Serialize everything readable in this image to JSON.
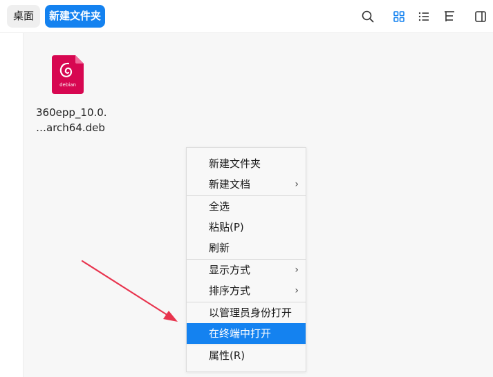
{
  "breadcrumb": {
    "items": [
      "桌面",
      "新建文件夹"
    ]
  },
  "toolbar": {
    "icons": [
      "search-icon",
      "icon-view-icon",
      "list-view-icon",
      "tree-view-icon",
      "detail-panel-icon"
    ],
    "active_view": "icon-view-icon",
    "accent_color": "#1482f0"
  },
  "files": [
    {
      "name_line1": "360epp_10.0.",
      "name_line2": "…arch64.deb",
      "icon_label": "debian",
      "icon_color": "#d70751"
    }
  ],
  "context_menu": {
    "groups": [
      [
        {
          "label": "新建文件夹",
          "submenu": false
        },
        {
          "label": "新建文档",
          "submenu": true
        }
      ],
      [
        {
          "label": "全选",
          "submenu": false
        },
        {
          "label": "粘贴(P)",
          "submenu": false
        },
        {
          "label": "刷新",
          "submenu": false
        }
      ],
      [
        {
          "label": "显示方式",
          "submenu": true
        },
        {
          "label": "排序方式",
          "submenu": true
        }
      ],
      [
        {
          "label": "以管理员身份打开",
          "submenu": false
        },
        {
          "label": "在终端中打开",
          "submenu": false,
          "highlighted": true
        },
        {
          "label": "属性(R)",
          "submenu": false
        }
      ]
    ],
    "submenu_glyph": "›",
    "highlight_color": "#1482f0"
  },
  "annotation": {
    "arrow_color": "#e8344e"
  }
}
